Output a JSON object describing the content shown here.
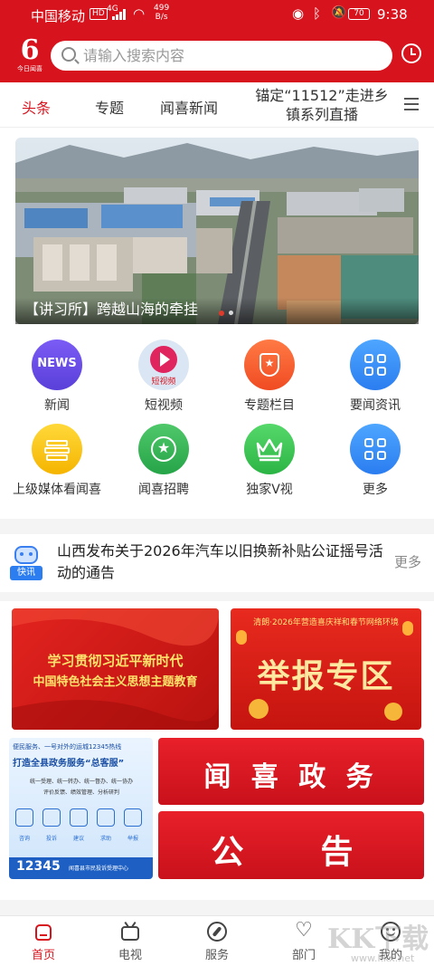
{
  "status_bar": {
    "carrier": "中国移动",
    "hd": "HD",
    "signal_type": "4G",
    "speed_value": "499",
    "speed_unit": "B/s",
    "battery": "70",
    "time": "9:38"
  },
  "header": {
    "logo_text": "今日闻喜",
    "search_placeholder": "请输入搜索内容"
  },
  "tabs": [
    {
      "label": "头条",
      "active": true
    },
    {
      "label": "专题",
      "active": false
    },
    {
      "label": "闻喜新闻",
      "active": false
    },
    {
      "label": "锚定“11512”走进乡镇系列直播",
      "active": false
    }
  ],
  "banner": {
    "caption": "【讲习所】跨越山海的牵挂"
  },
  "quick_links": [
    {
      "label": "新闻",
      "icon": "news-icon"
    },
    {
      "label": "短视频",
      "icon": "short-video-icon"
    },
    {
      "label": "专题栏目",
      "icon": "special-column-icon"
    },
    {
      "label": "要闻资讯",
      "icon": "grid-apps-icon"
    },
    {
      "label": "上级媒体看闻喜",
      "icon": "media-books-icon"
    },
    {
      "label": "闻喜招聘",
      "icon": "star-badge-icon"
    },
    {
      "label": "独家V视",
      "icon": "crown-icon"
    },
    {
      "label": "更多",
      "icon": "grid-apps-icon"
    }
  ],
  "icon_texts": {
    "news": "NEWS",
    "short_video": "短视频",
    "kuaixun": "快讯"
  },
  "flash_news": {
    "text": "山西发布关于2026年汽车以旧换新补贴公证摇号活动的通告",
    "more": "更多"
  },
  "promos": {
    "study": {
      "line1": "学习贯彻习近平新时代",
      "line2": "中国特色社会主义思想主题教育"
    },
    "report": {
      "subtitle": "清朗·2026年营造喜庆祥和春节网络环境",
      "title": "举报专区"
    },
    "hotline": {
      "line1": "便民服务、一号对外的运城12345热线",
      "line2": "打造全县政务服务“总客服”",
      "line3": "统一受理、统一转办、统一督办、统一协办",
      "line4": "评价反馈、绩效管理、分析研判",
      "icons": [
        "咨询",
        "投诉",
        "建议",
        "求助",
        "举报"
      ],
      "number": "12345",
      "org": "闻喜县市民投诉受理中心"
    },
    "gov": {
      "title": "闻 喜 政 务"
    },
    "notice": {
      "title": "公  告"
    }
  },
  "bottom_nav": [
    {
      "label": "首页",
      "icon": "home-icon",
      "active": true
    },
    {
      "label": "电视",
      "icon": "tv-icon",
      "active": false
    },
    {
      "label": "服务",
      "icon": "compass-icon",
      "active": false
    },
    {
      "label": "部门",
      "icon": "heart-icon",
      "active": false
    },
    {
      "label": "我的",
      "icon": "smile-icon",
      "active": false
    }
  ],
  "watermark": {
    "text": "KK下载",
    "url": "www.kkx.net"
  },
  "colors": {
    "brand_red": "#d7141e",
    "background": "#f4f4f4"
  }
}
